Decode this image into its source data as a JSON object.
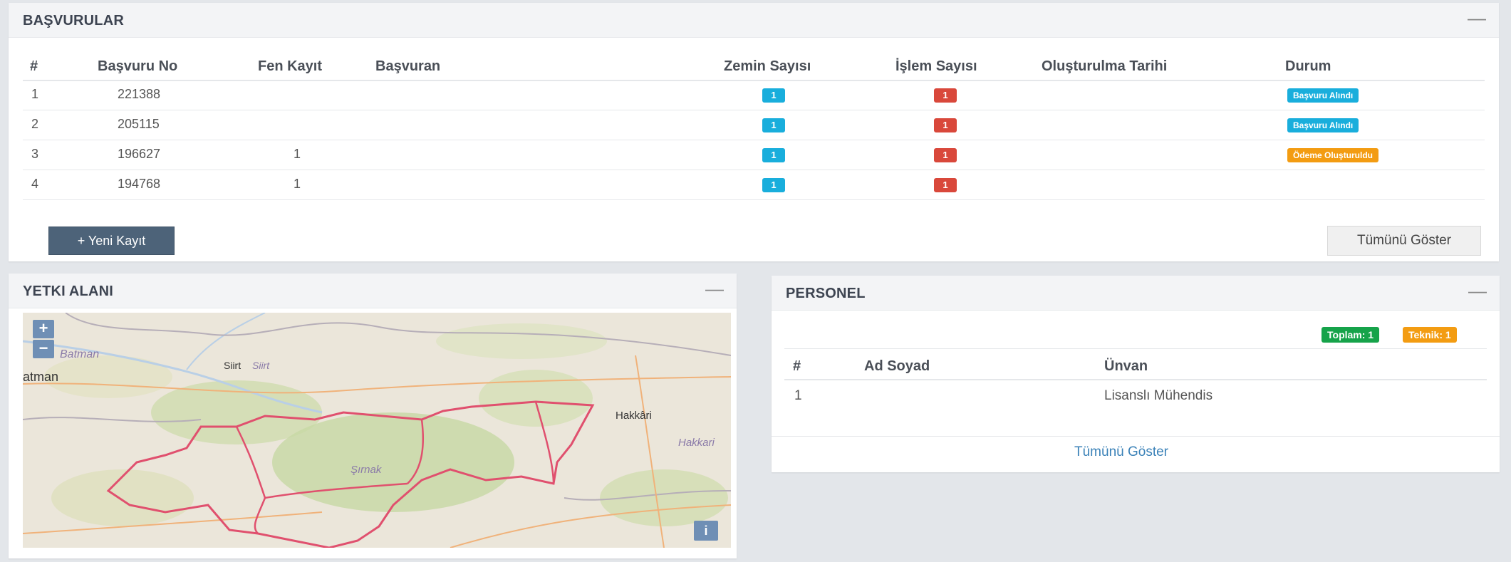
{
  "basvurular": {
    "title": "BAŞVURULAR",
    "collapse": "—",
    "columns": [
      "#",
      "Başvuru No",
      "Fen Kayıt",
      "Başvuran",
      "Zemin Sayısı",
      "İşlem Sayısı",
      "Oluşturulma Tarihi",
      "Durum"
    ],
    "rows": [
      {
        "index": "1",
        "no": "221388",
        "fen": "",
        "basvuran": "",
        "zemin": "1",
        "islem": "1",
        "tarih": "",
        "durum": "Başvuru Alındı",
        "durum_color": "#19aedc"
      },
      {
        "index": "2",
        "no": "205115",
        "fen": "",
        "basvuran": "",
        "zemin": "1",
        "islem": "1",
        "tarih": "",
        "durum": "Başvuru Alındı",
        "durum_color": "#19aedc"
      },
      {
        "index": "3",
        "no": "196627",
        "fen": "1",
        "basvuran": "",
        "zemin": "1",
        "islem": "1",
        "tarih": "",
        "durum": "Ödeme Oluşturuldu",
        "durum_color": "#f39c12"
      },
      {
        "index": "4",
        "no": "194768",
        "fen": "1",
        "basvuran": "",
        "zemin": "1",
        "islem": "1",
        "tarih": "",
        "durum": "",
        "durum_color": ""
      }
    ],
    "new_button": "+ Yeni Kayıt",
    "show_all_button": "Tümünü Göster"
  },
  "yetki": {
    "title": "YETKI ALANI",
    "collapse": "—",
    "zoom_in": "+",
    "zoom_out": "−",
    "info": "i",
    "labels": {
      "batman_italic": "Batman",
      "batman": "atman",
      "siirt": "Siirt",
      "siirt_italic": "Siirt",
      "sirnak": "Şırnak",
      "hakkari": "Hakkâri",
      "hakkari_italic": "Hakkari"
    }
  },
  "personel": {
    "title": "PERSONEL",
    "collapse": "—",
    "toplam": "Toplam: 1",
    "teknik": "Teknik: 1",
    "columns": [
      "#",
      "Ad Soyad",
      "Ünvan"
    ],
    "rows": [
      {
        "index": "1",
        "ad": "",
        "unvan": "Lisanslı Mühendis"
      }
    ],
    "show_all": "Tümünü Göster"
  },
  "colors": {
    "accent_blue": "#19aedc",
    "accent_red": "#d9483b",
    "accent_orange": "#f39c12",
    "accent_green": "#16a34a",
    "button_dark": "#4d6379"
  }
}
